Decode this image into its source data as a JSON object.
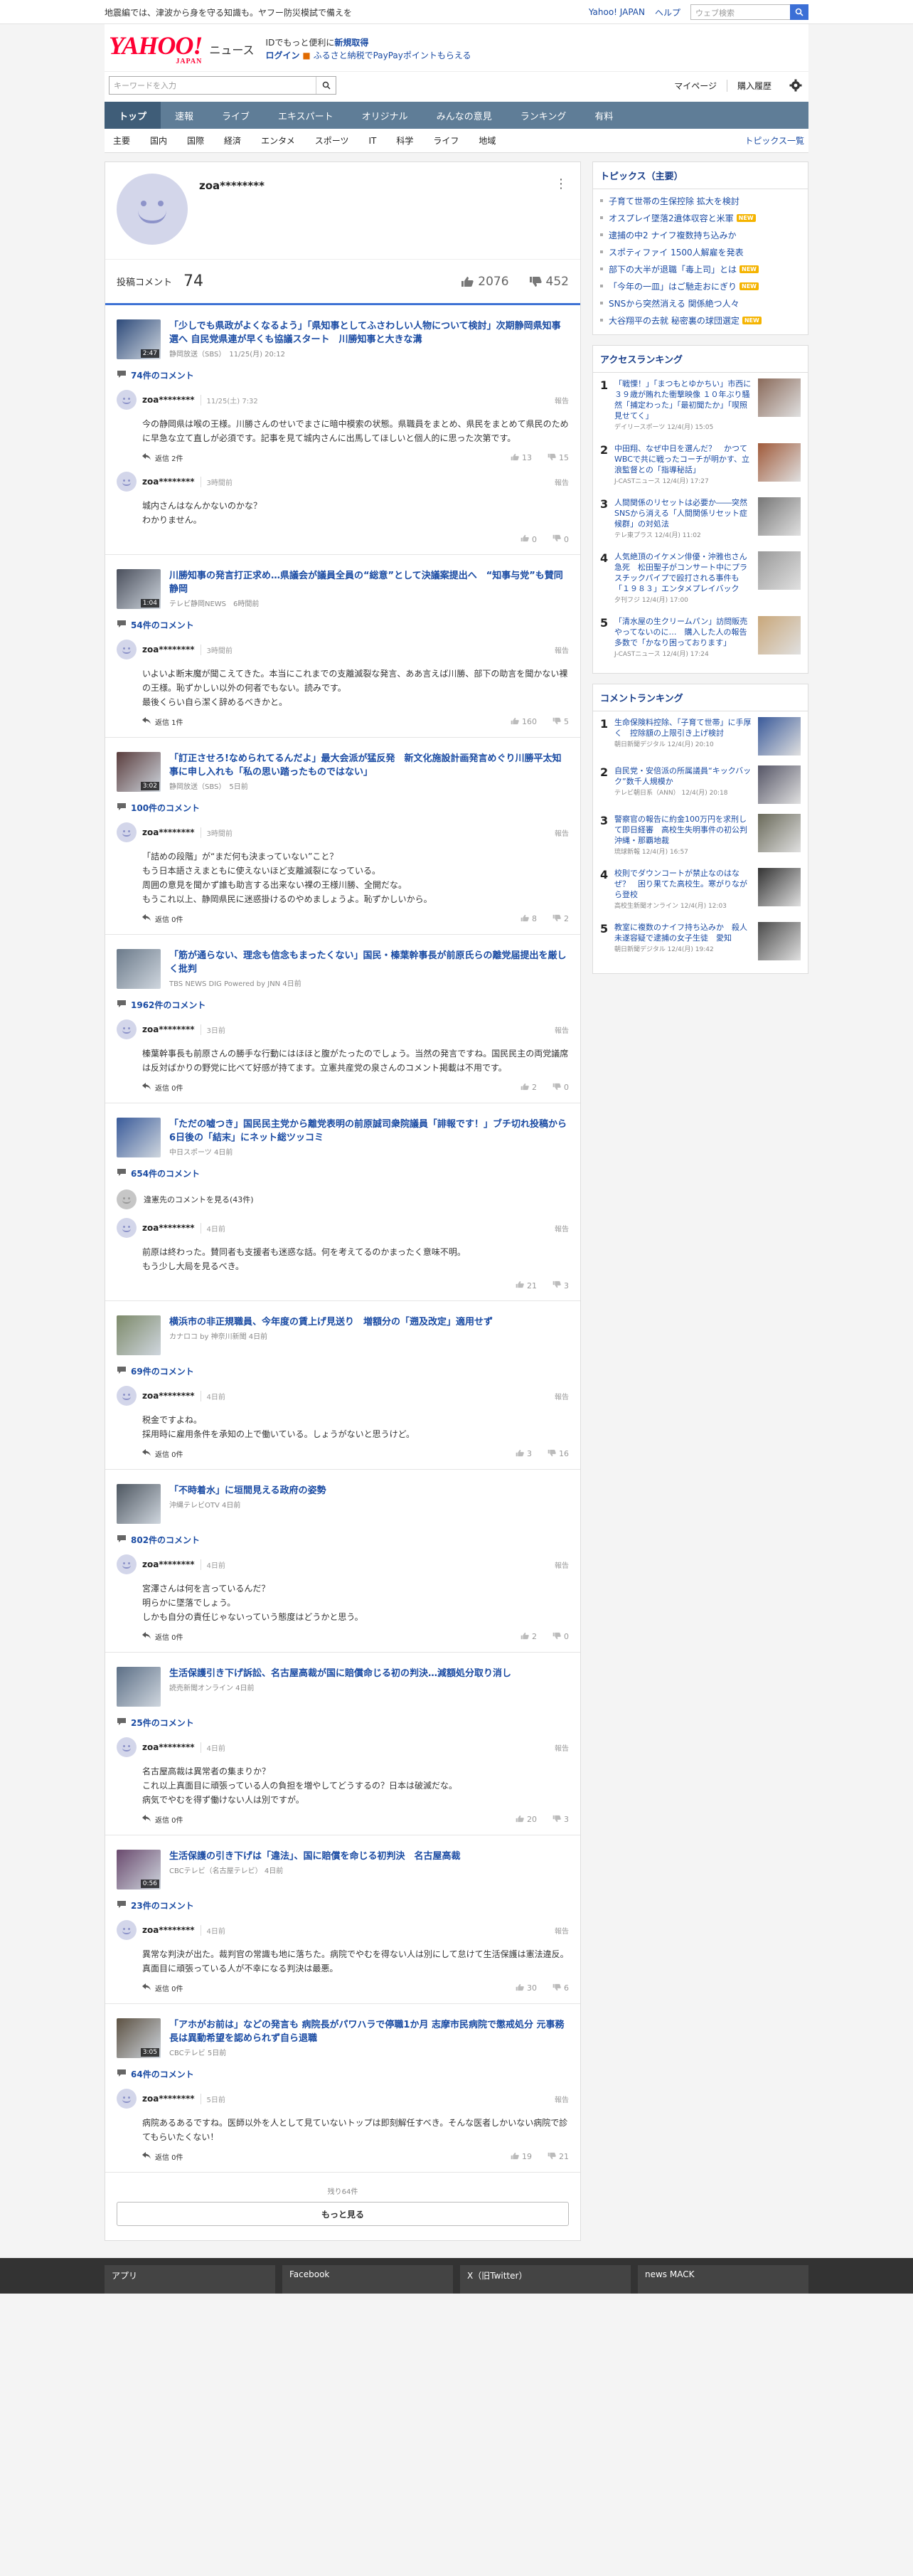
{
  "topbar": {
    "notice": "地震編では、津波から身を守る知識も。ヤフー防災模試で備えを",
    "links": [
      "Yahoo! JAPAN",
      "ヘルプ"
    ],
    "search_placeholder": "ウェブ検索"
  },
  "header": {
    "logo": "YAHOO!",
    "logo_sub": "JAPAN",
    "service": "ニュース",
    "promo_line1_prefix": "IDでもっと便利に",
    "promo_line1_link": "新規取得",
    "promo_line2_link": "ログイン",
    "promo_line2_text": "ふるさと納税でPayPayポイントもらえる"
  },
  "search": {
    "placeholder": "キーワードを入力",
    "links": [
      "マイページ",
      "購入履歴"
    ]
  },
  "nav": {
    "items": [
      "トップ",
      "速報",
      "ライブ",
      "エキスパート",
      "オリジナル",
      "みんなの意見",
      "ランキング",
      "有料"
    ],
    "active": 0
  },
  "subnav": {
    "items": [
      "主要",
      "国内",
      "国際",
      "経済",
      "エンタメ",
      "スポーツ",
      "IT",
      "科学",
      "ライフ",
      "地域"
    ],
    "more": "トピックス一覧"
  },
  "profile": {
    "name": "zoa********",
    "comments_label": "投稿コメント",
    "comments_count": "74",
    "likes": "2076",
    "dislikes": "452"
  },
  "entries": [
    {
      "title": "「少しでも県政がよくなるよう」「県知事としてふさわしい人物について検討」次期静岡県知事選へ 自民党県連が早くも協議スタート　川勝知事と大きな溝",
      "meta": "静岡放送（SBS）　11/25(月) 20:12",
      "duration": "2:47",
      "thumb": "#2d4a7a",
      "ccount": "74件のコメント",
      "hidden": "",
      "comments": [
        {
          "user": "zoa********",
          "time": "11/25(土) 7:32",
          "body": "今の静岡県は喉の王様。川勝さんのせいでまさに暗中模索の状態。県職員をまとめ、県民をまとめて県民のために早急な立て直しが必須です。記事を見て城内さんに出馬してほしいと個人的に思った次第です。",
          "reply": "返信 2件",
          "good": "13",
          "bad": "15"
        },
        {
          "user": "zoa********",
          "time": "3時間前",
          "body": "城内さんはなんかないのかな？\nわかりません。",
          "reply": "",
          "good": "0",
          "bad": "0"
        }
      ]
    },
    {
      "title": "川勝知事の発言打正求め…県議会が議員全員の“総意”として決議案提出へ　“知事与党”も賛同　静岡",
      "meta": "テレビ静岡NEWS　6時間前",
      "duration": "1:04",
      "thumb": "#4a4f5c",
      "ccount": "54件のコメント",
      "hidden": "",
      "comments": [
        {
          "user": "zoa********",
          "time": "3時間前",
          "body": "いよいよ断末魔が聞こえてきた。本当にこれまでの支離滅裂な発言、ああ言えば川勝、部下の助言を聞かない裸の王様。恥ずかしい以外の何者でもない。読みです。\n最後くらい自ら潔く辞めるべきかと。",
          "reply": "返信 1件",
          "good": "160",
          "bad": "5"
        }
      ]
    },
    {
      "title": "「訂正させろ!なめられてるんだよ」最大会派が猛反発　新文化施設計画発言めぐり川勝平太知事に申し入れも「私の思い踏ったものではない」",
      "meta": "静岡放送（SBS）　5日前",
      "duration": "3:02",
      "thumb": "#5a3d3d",
      "ccount": "100件のコメント",
      "hidden": "",
      "comments": [
        {
          "user": "zoa********",
          "time": "3時間前",
          "body": "「詰めの段階」が“まだ何も決まっていない”こと？\nもう日本語さえまともに使えないほど支離滅裂になっている。\n周囲の意見を聞かず誰も助言する出来ない裸の王様川勝、全開だな。\nもうこれ以上、静岡県民に迷惑掛けるのやめましょうよ。恥ずかしいから。",
          "reply": "返信 0件",
          "good": "8",
          "bad": "2"
        }
      ]
    },
    {
      "title": "「筋が通らない、理念も信念もまったくない」国民・榛葉幹事長が前原氏らの離党届提出を厳しく批判",
      "meta": "TBS NEWS DIG Powered by JNN 4日前",
      "duration": "",
      "thumb": "#6b7a8a",
      "ccount": "1962件のコメント",
      "hidden": "",
      "comments": [
        {
          "user": "zoa********",
          "time": "3日前",
          "body": "榛葉幹事長も前原さんの勝手な行動にはほほと腹がたったのでしょう。当然の発言ですね。国民民主の両党議席は反対ばかりの野党に比べて好感が持てます。立憲共産党の泉さんのコメント掲載は不用です。",
          "reply": "返信 0件",
          "good": "2",
          "bad": "0"
        }
      ]
    },
    {
      "title": "「ただの嘘つき」国民民主党から離党表明の前原誠司衆院議員「誹報です！」ブチ切れ投稿から6日後の「結末」にネット総ツッコミ",
      "meta": "中日スポーツ 4日前",
      "duration": "",
      "thumb": "#3a5b9a",
      "ccount": "654件のコメント",
      "hidden": "違憲先のコメントを見る(43件)",
      "comments": [
        {
          "user": "zoa********",
          "time": "4日前",
          "body": "前原は終わった。賛同者も支援者も迷惑な話。何を考えてるのかまったく意味不明。\nもう少し大局を見るべき。",
          "reply": "",
          "good": "21",
          "bad": "3"
        }
      ]
    },
    {
      "title": "横浜市の非正規職員、今年度の賃上げ見送り　増額分の「遡及改定」適用せず",
      "meta": "カナロコ by 神奈川新聞 4日前",
      "duration": "",
      "thumb": "#7d8a6a",
      "ccount": "69件のコメント",
      "hidden": "",
      "comments": [
        {
          "user": "zoa********",
          "time": "4日前",
          "body": "税金ですよね。\n採用時に雇用条件を承知の上で働いている。しょうがないと思うけど。",
          "reply": "返信 0件",
          "good": "3",
          "bad": "16"
        }
      ]
    },
    {
      "title": "「不時着水」に垣間見える政府の姿勢",
      "meta": "沖縄テレビOTV 4日前",
      "duration": "",
      "thumb": "#4d5660",
      "ccount": "802件のコメント",
      "hidden": "",
      "comments": [
        {
          "user": "zoa********",
          "time": "4日前",
          "body": "宮澤さんは何を言っているんだ？\n明らかに墜落でしょう。\nしかも自分の責任じゃないっていう態度はどうかと思う。",
          "reply": "返信 0件",
          "good": "2",
          "bad": "0"
        }
      ]
    },
    {
      "title": "生活保護引き下げ訴訟、名古屋高裁が国に賠償命じる初の判決…減額処分取り消し",
      "meta": "読売新聞オンライン 4日前",
      "duration": "",
      "thumb": "#5c6f86",
      "ccount": "25件のコメント",
      "hidden": "",
      "comments": [
        {
          "user": "zoa********",
          "time": "4日前",
          "body": "名古屋高裁は異常者の集まりか？\nこれ以上真面目に頑張っている人の負担を増やしてどうするの？日本は破滅だな。\n病気でやむを得ず働けない人は別ですが。",
          "reply": "返信 0件",
          "good": "20",
          "bad": "3"
        }
      ]
    },
    {
      "title": "生活保護の引き下げは「違法」、国に賠償を命じる初判決　名古屋高裁",
      "meta": "CBCテレビ（名古屋テレビ） 4日前",
      "duration": "0:56",
      "thumb": "#6a4a6e",
      "ccount": "23件のコメント",
      "hidden": "",
      "comments": [
        {
          "user": "zoa********",
          "time": "4日前",
          "body": "異常な判決が出た。裁判官の常識も地に落ちた。病院でやむを得ない人は別にして怠けて生活保護は憲法違反。真面目に頑張っている人が不幸になる判決は最悪。",
          "reply": "返信 0件",
          "good": "30",
          "bad": "6"
        }
      ]
    },
    {
      "title": "「アホがお前は」などの発言も 病院長がパワハラで停職1か月 志摩市民病院で懲戒処分 元事務長は異動希望を認められず自ら退職",
      "meta": "CBCテレビ 5日前",
      "duration": "3:05",
      "thumb": "#5d5243",
      "ccount": "64件のコメント",
      "hidden": "",
      "comments": [
        {
          "user": "zoa********",
          "time": "5日前",
          "body": "病院あるあるですね。医師以外を人として見ていないトップは即刻解任すべき。そんな医者しかいない病院で診てもらいたくない！",
          "reply": "返信 0件",
          "good": "19",
          "bad": "21"
        }
      ]
    }
  ],
  "more": {
    "remaining": "残り64件",
    "button": "もっと見る"
  },
  "topics": {
    "title": "トピックス（主要）",
    "items": [
      {
        "text": "子育て世帯の生保控除 拡大を検討",
        "badge": ""
      },
      {
        "text": "オスプレイ墜落2遺体収容と米軍",
        "badge": "NEW"
      },
      {
        "text": "逮捕の中2 ナイフ複数持ち込みか",
        "badge": ""
      },
      {
        "text": "スポティファイ 1500人解雇を発表",
        "badge": ""
      },
      {
        "text": "部下の大半が退職「毒上司」とは",
        "badge": "NEW"
      },
      {
        "text": "「今年の一皿」はご馳走おにぎり",
        "badge": "NEW"
      },
      {
        "text": "SNSから突然消える 関係絶つ人々",
        "badge": ""
      },
      {
        "text": "大谷翔平の去就 秘密裏の球団選定",
        "badge": "NEW"
      }
    ]
  },
  "access_ranking": {
    "title": "アクセスランキング",
    "items": [
      {
        "num": "1",
        "text": "「戦慄！」「まつもとゆかちい」市西に３９歳が賄れた衝撃映像 １０年ぶり騒然「捕定わった」「最初聞たか」「喫照見せてく」",
        "src": "デイリースポーツ 12/4(月) 15:05",
        "thumb": "#8a6a5a"
      },
      {
        "num": "2",
        "text": "中田翔、なぜ中日を選んだ？　かつてWBCで共に戦ったコーチが明かす、立浪監督との「指導秘話」",
        "src": "J-CASTニュース 12/4(月) 17:27",
        "thumb": "#a05a3a"
      },
      {
        "num": "3",
        "text": "人間関係のリセットは必要か――突然SNSから消える「人間関係リセット症候群」の対処法",
        "src": "テレ東プラス 12/4(月) 11:02",
        "thumb": "#777"
      },
      {
        "num": "4",
        "text": "人気絶頂のイケメン俳優・沖雅也さん急死　松田聖子がコンサート中にプラスチックパイプで殴打される事件も　「１９８３」エンタメプレイバック",
        "src": "夕刊フジ 12/4(月) 17:00",
        "thumb": "#999"
      },
      {
        "num": "5",
        "text": "「清水屋の生クリームパン」訪問販売やってないのに…　購入した人の報告多数で「かなり困っております」",
        "src": "J-CASTニュース 12/4(月) 17:24",
        "thumb": "#c9a77a"
      }
    ]
  },
  "comment_ranking": {
    "title": "コメントランキング",
    "items": [
      {
        "num": "1",
        "text": "生命保険料控除、「子育て世帯」に手厚く　控除額の上限引き上げ検討",
        "src": "朝日新聞デジタル 12/4(月) 20:10",
        "thumb": "#3a5a9a"
      },
      {
        "num": "2",
        "text": "自民党・安倍派の所属議員“キックバック”数千人規模か",
        "src": "テレビ朝日系（ANN） 12/4(月) 20:18",
        "thumb": "#556"
      },
      {
        "num": "3",
        "text": "警察官の報告に約金100万円を求刑して即日経審　高校生失明事件の初公判　沖縄・那覇地裁",
        "src": "琉球新報 12/4(月) 16:57",
        "thumb": "#6a6a5a"
      },
      {
        "num": "4",
        "text": "校則でダウンコートが禁止なのはなぜ？　困り果てた高校生。寒がりながら登校",
        "src": "高校生新聞オンライン 12/4(月) 12:03",
        "thumb": "#333"
      },
      {
        "num": "5",
        "text": "教室に複数のナイフ持ち込みか　殺人未遂容疑で逮捕の女子生徒　愛知",
        "src": "朝日新聞デジタル 12/4(月) 19:42",
        "thumb": "#4a4a4a"
      }
    ]
  },
  "footer": {
    "items": [
      "アプリ",
      "Facebook",
      "X（旧Twitter）",
      "news MACK"
    ]
  }
}
